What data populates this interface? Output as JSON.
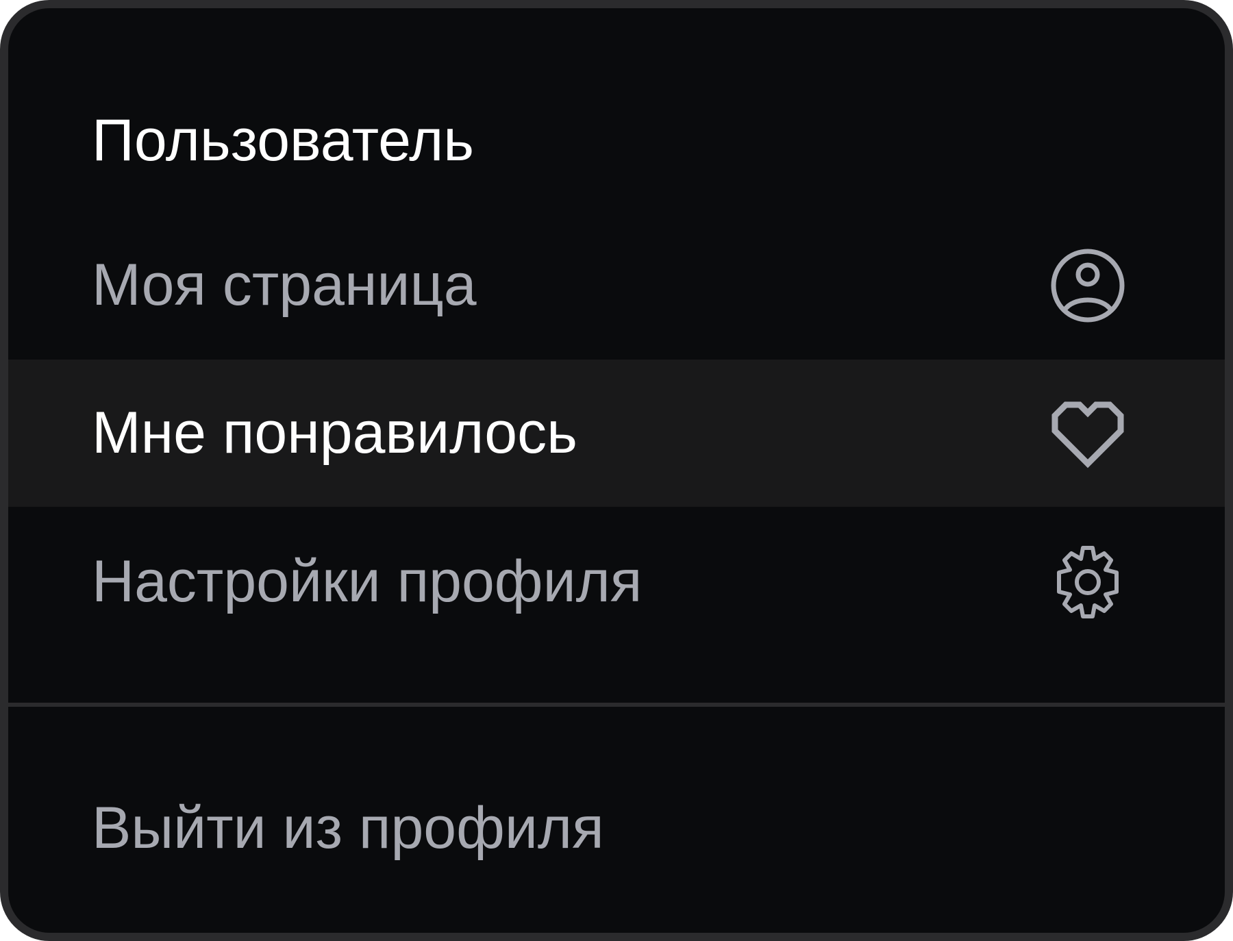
{
  "menu": {
    "title": "Пользователь",
    "items": [
      {
        "label": "Моя страница",
        "icon": "user-circle-icon"
      },
      {
        "label": "Мне понравилось",
        "icon": "heart-icon",
        "highlighted": true
      },
      {
        "label": "Настройки профиля",
        "icon": "gear-icon"
      }
    ],
    "logout": {
      "label": "Выйти из профиля"
    }
  },
  "colors": {
    "background": "#0a0b0d",
    "border": "#2b2b2d",
    "highlight": "#19191a",
    "text_primary": "#ffffff",
    "text_secondary": "#a7a9b1",
    "icon": "#a7a9b1"
  }
}
